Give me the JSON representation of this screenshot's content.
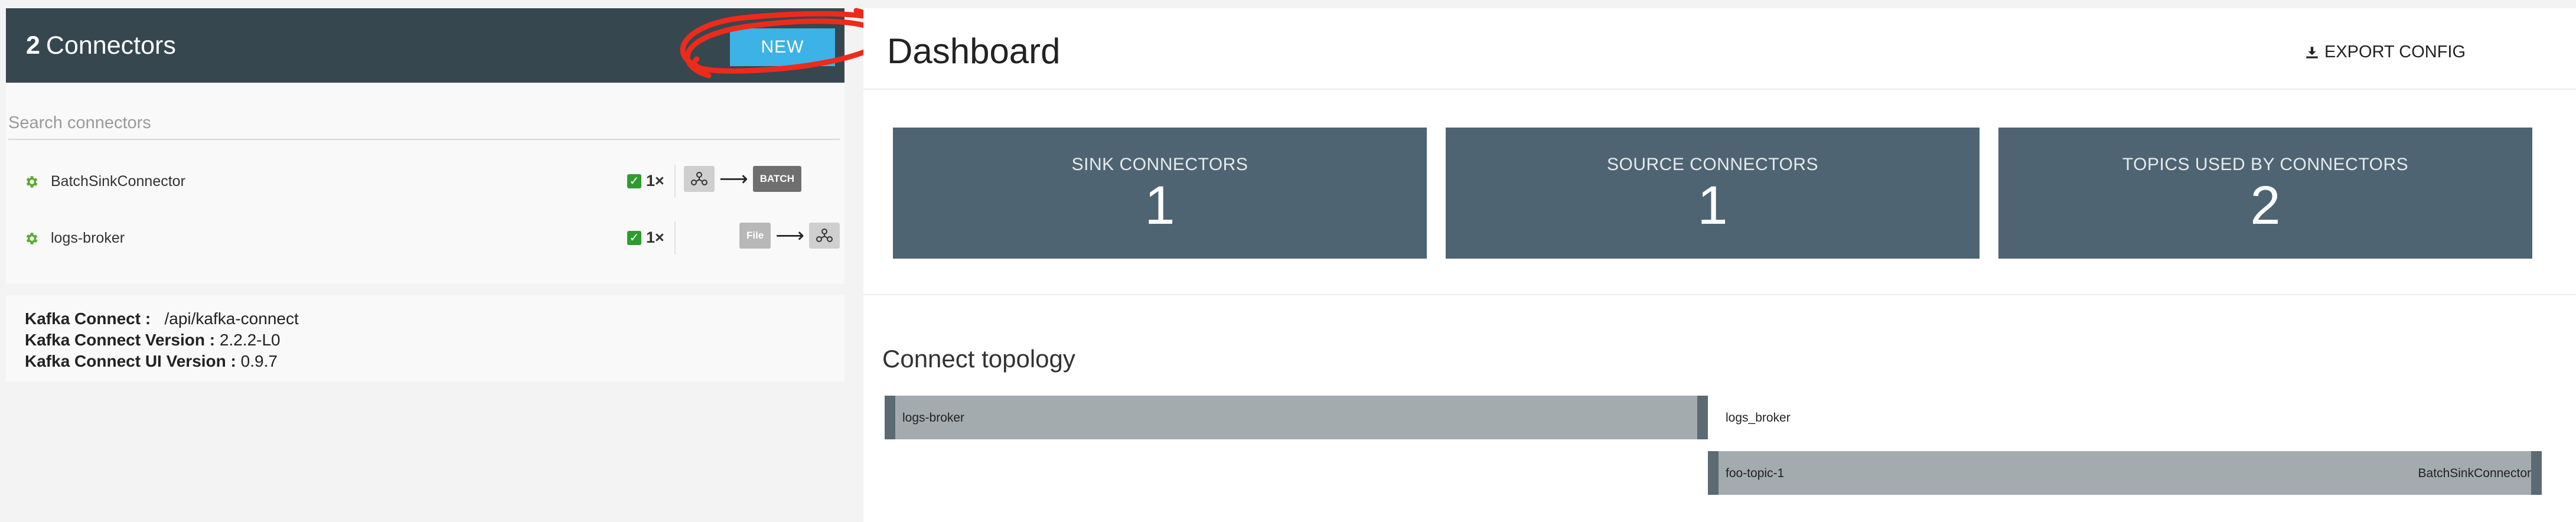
{
  "connectors_panel": {
    "count": "2",
    "title": "Connectors",
    "new_button": "NEW",
    "search_placeholder": "Search connectors",
    "items": [
      {
        "name": "BatchSinkConnector",
        "tasks": "1×",
        "target_label": "BATCH",
        "target_color": "#6f6f6f"
      },
      {
        "name": "logs-broker",
        "tasks": "1×",
        "source_label": "File",
        "source_color": "#b8b8b8"
      }
    ]
  },
  "info": {
    "kafka_connect_label": "Kafka Connect :",
    "kafka_connect_value": "/api/kafka-connect",
    "version_label": "Kafka Connect Version :",
    "version_value": "2.2.2-L0",
    "ui_version_label": "Kafka Connect UI Version :",
    "ui_version_value": "0.9.7"
  },
  "dashboard": {
    "title": "Dashboard",
    "export_button": "EXPORT CONFIG",
    "stats": [
      {
        "label": "SINK CONNECTORS",
        "value": "1"
      },
      {
        "label": "SOURCE CONNECTORS",
        "value": "1"
      },
      {
        "label": "TOPICS USED BY CONNECTORS",
        "value": "2"
      }
    ],
    "topology": {
      "title": "Connect topology",
      "rows": [
        {
          "left": "logs-broker",
          "right": "logs_broker"
        },
        {
          "left": "foo-topic-1",
          "right": "BatchSinkConnector"
        }
      ]
    }
  },
  "colors": {
    "header_bg": "#37474f",
    "new_button": "#3cb2e6",
    "stat_bg": "#4f6472",
    "annotation": "#ee2a1b",
    "success": "#2e9b2e"
  }
}
